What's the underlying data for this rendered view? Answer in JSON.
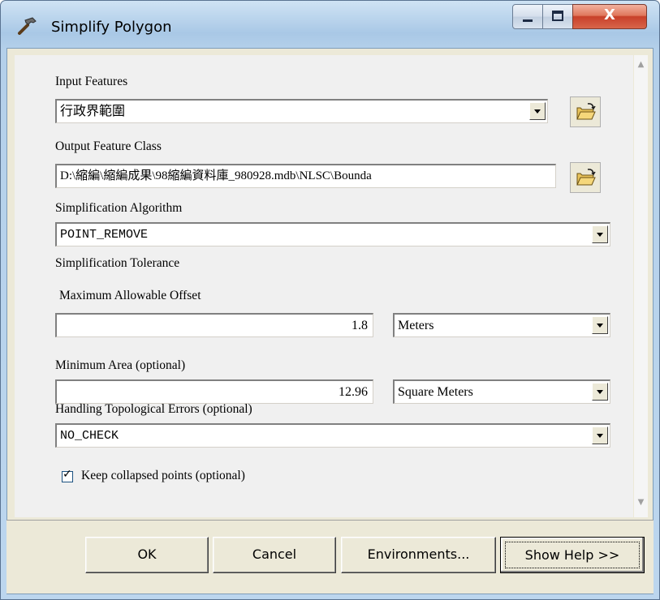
{
  "window": {
    "title": "Simplify Polygon",
    "controls": {
      "minimize": "minimize-icon",
      "maximize": "maximize-icon",
      "close": "close-icon"
    },
    "close_glyph": "X"
  },
  "form": {
    "input_features": {
      "label": "Input Features",
      "value": "行政界範圍"
    },
    "output_feature_class": {
      "label": "Output Feature Class",
      "value": "D:\\縮編\\縮編成果\\98縮編資料庫_980928.mdb\\NLSC\\Bounda"
    },
    "simplification_algorithm": {
      "label": "Simplification Algorithm",
      "value": "POINT_REMOVE"
    },
    "simplification_tolerance": {
      "label": "Simplification Tolerance"
    },
    "max_allowable_offset": {
      "label": "Maximum Allowable Offset",
      "value": "1.8",
      "unit": "Meters"
    },
    "minimum_area": {
      "label": "Minimum Area (optional)",
      "value": "12.96",
      "unit": "Square Meters"
    },
    "topological_errors": {
      "label": "Handling Topological Errors (optional)",
      "value": "NO_CHECK"
    },
    "keep_collapsed": {
      "label": "Keep collapsed points (optional)",
      "checked": true
    }
  },
  "buttons": {
    "ok": "OK",
    "cancel": "Cancel",
    "environments": "Environments...",
    "show_help": "Show Help >>"
  },
  "colors": {
    "title_bar": "#b9d1ea",
    "close_button": "#c8402a",
    "panel": "#f0f0f0",
    "dialog_face": "#ece9d8"
  }
}
